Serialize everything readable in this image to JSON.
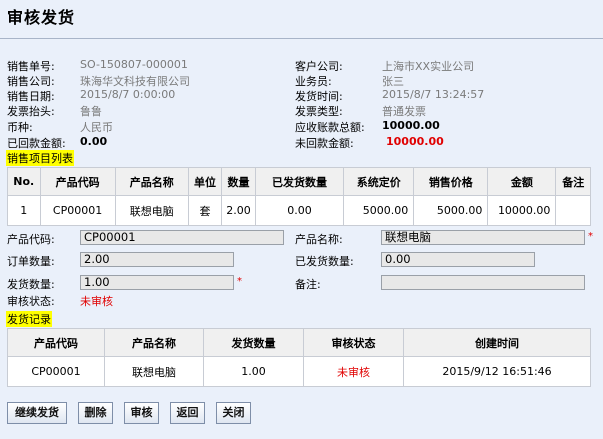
{
  "page": {
    "title": "审核发货"
  },
  "info": {
    "left": [
      {
        "label": "销售单号:",
        "value": "SO-150807-000001"
      },
      {
        "label": "销售公司:",
        "value": "珠海华文科技有限公司"
      },
      {
        "label": "销售日期:",
        "value": "2015/8/7 0:00:00"
      },
      {
        "label": "发票抬头:",
        "value": "鲁鲁"
      },
      {
        "label": "币种:",
        "value": "人民币"
      },
      {
        "label": "已回款金额:",
        "value": "0.00"
      }
    ],
    "right": [
      {
        "label": "客户公司:",
        "value": "上海市XX实业公司"
      },
      {
        "label": "业务员:",
        "value": "张三"
      },
      {
        "label": "发货时间:",
        "value": "2015/8/7 13:24:57"
      },
      {
        "label": "发票类型:",
        "value": "普通发票"
      },
      {
        "label": "应收账款总额:",
        "value": "10000.00"
      },
      {
        "label": "未回款金额:",
        "value": "10000.00"
      }
    ]
  },
  "items_section": {
    "label": "销售项目列表"
  },
  "items_table": {
    "headers": [
      "No.",
      "产品代码",
      "产品名称",
      "单位",
      "数量",
      "已发货数量",
      "系统定价",
      "销售价格",
      "金额",
      "备注"
    ],
    "rows": [
      [
        "1",
        "CP00001",
        "联想电脑",
        "套",
        "2.00",
        "0.00",
        "5000.00",
        "5000.00",
        "10000.00",
        ""
      ]
    ]
  },
  "form": {
    "product_code_label": "产品代码:",
    "product_code_value": "CP00001",
    "product_name_label": "产品名称:",
    "product_name_value": "联想电脑",
    "order_qty_label": "订单数量:",
    "order_qty_value": "2.00",
    "shipped_qty_label": "已发货数量:",
    "shipped_qty_value": "0.00",
    "ship_qty_label": "发货数量:",
    "ship_qty_value": "1.00",
    "remark_label": "备注:",
    "remark_value": "",
    "audit_status_label": "审核状态:",
    "audit_status_value": "未审核",
    "required_mark": "*"
  },
  "ship_section": {
    "label": "发货记录"
  },
  "ship_table": {
    "headers": [
      "产品代码",
      "产品名称",
      "发货数量",
      "审核状态",
      "创建时间"
    ],
    "rows": [
      [
        "CP00001",
        "联想电脑",
        "1.00",
        "未审核",
        "2015/9/12 16:51:46"
      ]
    ]
  },
  "buttons": {
    "continue": "继续发货",
    "delete": "删除",
    "audit": "审核",
    "back": "返回",
    "close": "关闭"
  },
  "colors": {
    "accent_red": "#e00000",
    "highlight": "#ffff00",
    "page_bg": "#eaf0fa"
  }
}
